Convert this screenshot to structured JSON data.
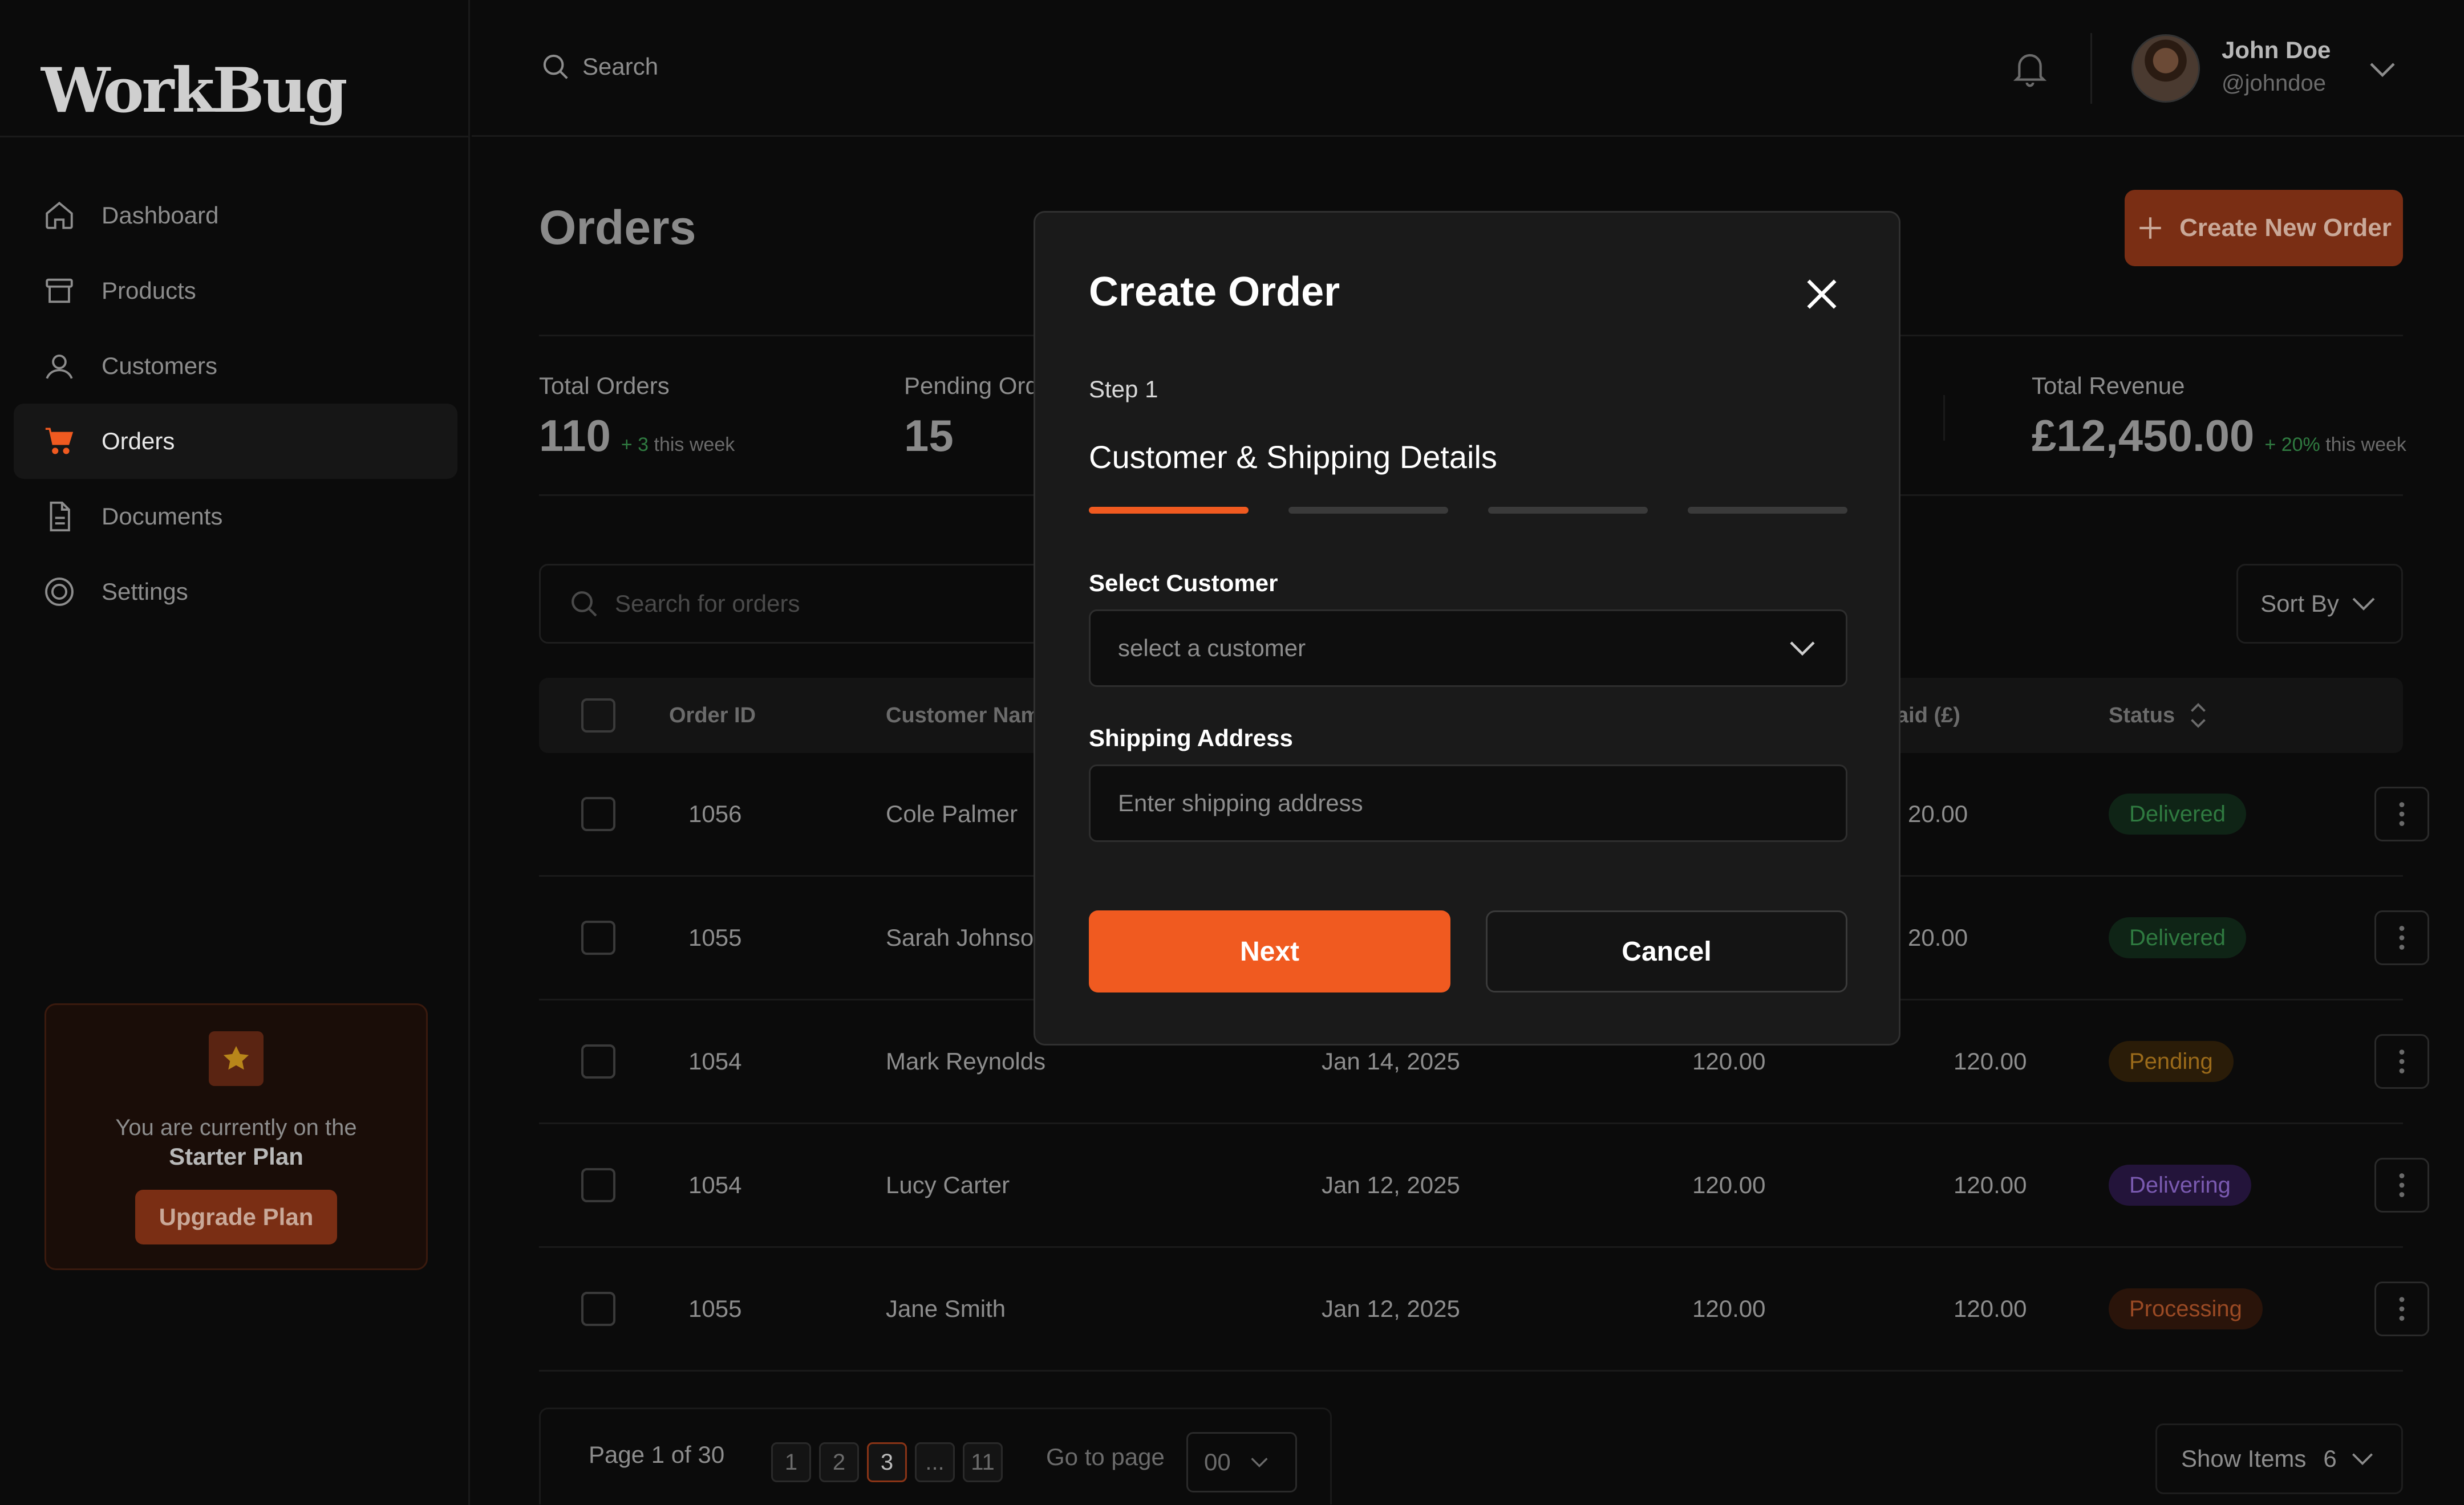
{
  "app": {
    "logo": "WorkBug"
  },
  "sidebar": {
    "items": [
      {
        "label": "Dashboard",
        "icon": "home-icon"
      },
      {
        "label": "Products",
        "icon": "box-icon"
      },
      {
        "label": "Customers",
        "icon": "users-icon"
      },
      {
        "label": "Orders",
        "icon": "cart-icon",
        "active": true
      },
      {
        "label": "Documents",
        "icon": "document-icon"
      },
      {
        "label": "Settings",
        "icon": "settings-icon"
      }
    ],
    "plan": {
      "text": "You are currently on the",
      "name": "Starter Plan",
      "button": "Upgrade Plan"
    }
  },
  "topbar": {
    "search_label": "Search",
    "user": {
      "name": "John Doe",
      "handle": "@johndoe"
    }
  },
  "main": {
    "title": "Orders",
    "create_button": "Create New Order",
    "stats": [
      {
        "label": "Total Orders",
        "value": "110",
        "delta": "+ 3",
        "delta_suffix": "this week"
      },
      {
        "label": "Pending Ord",
        "value": "15"
      },
      {
        "label": "Total Revenue",
        "value": "£12,450.00",
        "delta": "+ 20%",
        "delta_suffix": "this week"
      }
    ],
    "search_placeholder": "Search for orders",
    "sort_label": "Sort By",
    "table": {
      "headers": {
        "order_id": "Order ID",
        "customer": "Customer Name",
        "paid": "aid (£)",
        "status": "Status"
      },
      "rows": [
        {
          "id": "1056",
          "customer": "Cole Palmer",
          "date": "",
          "amount": "",
          "paid": "20.00",
          "status": "Delivered"
        },
        {
          "id": "1055",
          "customer": "Sarah Johnson",
          "date": "",
          "amount": "",
          "paid": "20.00",
          "status": "Delivered"
        },
        {
          "id": "1054",
          "customer": "Mark Reynolds",
          "date": "Jan 14, 2025",
          "amount": "120.00",
          "paid": "120.00",
          "status": "Pending"
        },
        {
          "id": "1054",
          "customer": "Lucy Carter",
          "date": "Jan 12, 2025",
          "amount": "120.00",
          "paid": "120.00",
          "status": "Delivering"
        },
        {
          "id": "1055",
          "customer": "Jane Smith",
          "date": "Jan 12, 2025",
          "amount": "120.00",
          "paid": "120.00",
          "status": "Processing"
        }
      ]
    },
    "pagination": {
      "label": "Page 1 of 30",
      "pages": [
        "1",
        "2",
        "3",
        "...",
        "11"
      ],
      "current": "3",
      "goto_label": "Go to page",
      "goto_value": "00",
      "show_items_label": "Show Items",
      "show_items_value": "6"
    }
  },
  "modal": {
    "title": "Create Order",
    "step": "Step 1",
    "step_title": "Customer & Shipping Details",
    "progress": {
      "current_step": 1,
      "total_steps": 4
    },
    "customer_label": "Select Customer",
    "customer_placeholder": "select a customer",
    "address_label": "Shipping Address",
    "address_placeholder": "Enter shipping address",
    "next_button": "Next",
    "cancel_button": "Cancel"
  },
  "colors": {
    "accent": "#f05a20",
    "background": "#0b0b0b",
    "modal": "#1a1a1a"
  }
}
